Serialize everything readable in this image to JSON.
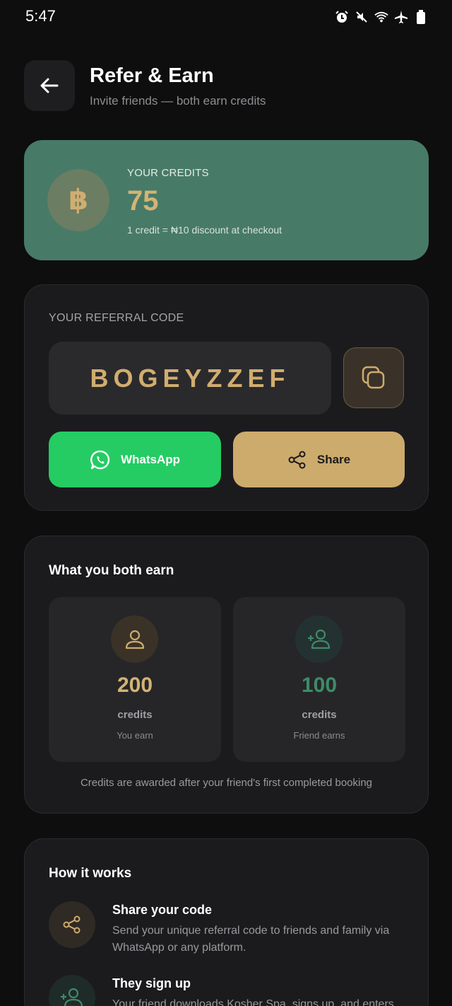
{
  "status_bar": {
    "time": "5:47",
    "icons": [
      "alarm-icon",
      "mute-icon",
      "wifi-icon",
      "airplane-icon",
      "battery-icon"
    ]
  },
  "header": {
    "title": "Refer & Earn",
    "subtitle": "Invite friends — both earn credits"
  },
  "credits": {
    "label": "YOUR CREDITS",
    "value": "75",
    "note": "1 credit = ₦10 discount at checkout",
    "coin_symbol": "฿"
  },
  "referral": {
    "label": "YOUR REFERRAL CODE",
    "code": "BOGEYZZEF",
    "whatsapp_label": "WhatsApp",
    "share_label": "Share"
  },
  "earn": {
    "title": "What you both earn",
    "you": {
      "value": "200",
      "unit": "credits",
      "caption": "You earn"
    },
    "friend": {
      "value": "100",
      "unit": "credits",
      "caption": "Friend earns"
    },
    "note": "Credits are awarded after your friend's first completed booking"
  },
  "how": {
    "title": "How it works",
    "steps": [
      {
        "title": "Share your code",
        "desc": "Send your unique referral code to friends and family via WhatsApp or any platform."
      },
      {
        "title": "They sign up",
        "desc": "Your friend downloads Kosher Spa, signs up, and enters"
      }
    ]
  },
  "colors": {
    "accent_gold": "#cdab6d",
    "accent_green": "#487a68",
    "whatsapp_green": "#24cc63",
    "background": "#0e0e0f"
  }
}
